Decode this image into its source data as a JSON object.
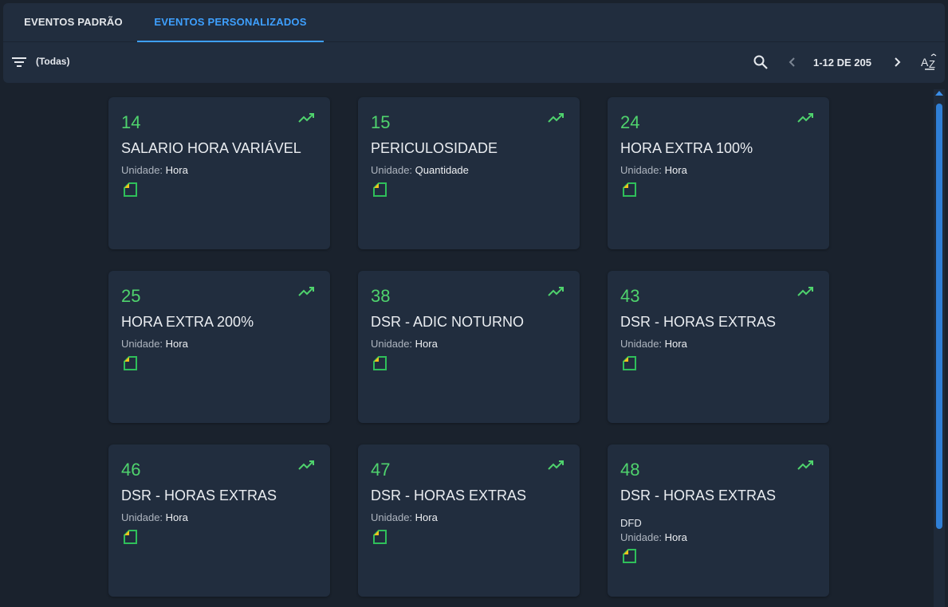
{
  "tabs": [
    {
      "label": "EVENTOS PADRÃO",
      "active": false
    },
    {
      "label": "EVENTOS PERSONALIZADOS",
      "active": true
    }
  ],
  "toolbar": {
    "filter_label": "(Todas)",
    "pager_text": "1-12 DE 205",
    "icons": [
      "filter-icon",
      "search-icon",
      "chevron-left-icon",
      "chevron-right-icon",
      "sort-az-icon"
    ]
  },
  "unit_prefix": "Unidade:",
  "colors": {
    "accent": "#3ea0ff",
    "code": "#4fd36d",
    "card": "#212d3e",
    "background": "#1a222d"
  },
  "cards": [
    {
      "code": "14",
      "name": "SALARIO HORA VARIÁVEL",
      "unit": "Hora",
      "extra": ""
    },
    {
      "code": "15",
      "name": "PERICULOSIDADE",
      "unit": "Quantidade",
      "extra": ""
    },
    {
      "code": "24",
      "name": "HORA EXTRA 100%",
      "unit": "Hora",
      "extra": ""
    },
    {
      "code": "25",
      "name": "HORA EXTRA 200%",
      "unit": "Hora",
      "extra": ""
    },
    {
      "code": "38",
      "name": "DSR - ADIC NOTURNO",
      "unit": "Hora",
      "extra": ""
    },
    {
      "code": "43",
      "name": "DSR - HORAS EXTRAS",
      "unit": "Hora",
      "extra": ""
    },
    {
      "code": "46",
      "name": "DSR - HORAS EXTRAS",
      "unit": "Hora",
      "extra": ""
    },
    {
      "code": "47",
      "name": "DSR - HORAS EXTRAS",
      "unit": "Hora",
      "extra": ""
    },
    {
      "code": "48",
      "name": "DSR - HORAS EXTRAS",
      "unit": "Hora",
      "extra": "DFD"
    }
  ]
}
